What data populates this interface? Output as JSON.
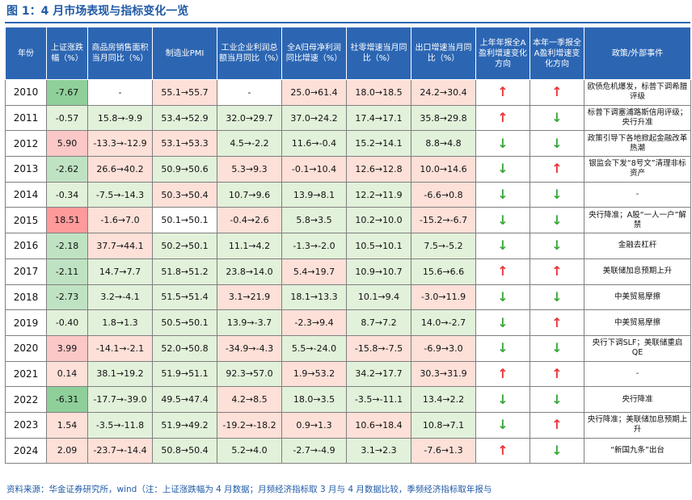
{
  "title": "图 1：4 月市场表现与指标变化一览",
  "colors": {
    "header_bg": "#2c66b3",
    "up_arrow": "#e8333a",
    "down_arrow": "#39a73a",
    "pos_strong": "#ff9a9a",
    "pos_light": "#fde0d8",
    "neg_strong": "#8fcf9a",
    "neg_light": "#e2f1da",
    "neutral": "#ffffff"
  },
  "chart_data": {
    "type": "table",
    "columns": [
      "年份",
      "上证涨跌幅（%）",
      "商品房销售面积当月同比（%）",
      "制造业PMI",
      "工业企业利润总额当月同比（%）",
      "全A归母净利润同比增速（%）",
      "社零增速当月同比（%）",
      "出口增速当月同比（%）",
      "上年年报全A盈利增速变化方向",
      "本年一季报全A盈利增速变化方向",
      "政策/外部事件"
    ],
    "rows": [
      {
        "year": "2010",
        "sse": "-7.67",
        "sales": "-",
        "pmi": "55.1→55.7",
        "profit": "-",
        "net": "25.0→61.4",
        "retail": "18.0→18.5",
        "export": "24.2→30.4",
        "annual": "up",
        "q1": "up",
        "event": "欧债危机爆发，标普下调希腊评级"
      },
      {
        "year": "2011",
        "sse": "-0.57",
        "sales": "15.8→-9.9",
        "pmi": "53.4→52.9",
        "profit": "32.0→29.7",
        "net": "37.0→24.2",
        "retail": "17.4→17.1",
        "export": "35.8→29.8",
        "annual": "up",
        "q1": "down",
        "event": "标普下调塞浦路斯信用评级；央行升准"
      },
      {
        "year": "2012",
        "sse": "5.90",
        "sales": "-13.3→-12.9",
        "pmi": "53.1→53.3",
        "profit": "4.5→-2.2",
        "net": "11.6→-0.4",
        "retail": "15.2→14.1",
        "export": "8.8→4.8",
        "annual": "down",
        "q1": "down",
        "event": "政策引导下各地掀起金融改革热潮"
      },
      {
        "year": "2013",
        "sse": "-2.62",
        "sales": "26.6→40.2",
        "pmi": "50.9→50.6",
        "profit": "5.3→9.3",
        "net": "-0.1→10.4",
        "retail": "12.6→12.8",
        "export": "10.0→14.6",
        "annual": "down",
        "q1": "up",
        "event": "银监会下发“8号文”清理非标资产"
      },
      {
        "year": "2014",
        "sse": "-0.34",
        "sales": "-7.5→-14.3",
        "pmi": "50.3→50.4",
        "profit": "10.7→9.6",
        "net": "13.9→8.1",
        "retail": "12.2→11.9",
        "export": "-6.6→0.8",
        "annual": "down",
        "q1": "down",
        "event": "-"
      },
      {
        "year": "2015",
        "sse": "18.51",
        "sales": "-1.6→7.0",
        "pmi": "50.1→50.1",
        "profit": "-0.4→2.6",
        "net": "5.8→3.5",
        "retail": "10.2→10.0",
        "export": "-15.2→-6.7",
        "annual": "down",
        "q1": "down",
        "event": "央行降准；A股“一人一户”解禁"
      },
      {
        "year": "2016",
        "sse": "-2.18",
        "sales": "37.7→44.1",
        "pmi": "50.2→50.1",
        "profit": "11.1→4.2",
        "net": "-1.3→-2.0",
        "retail": "10.5→10.1",
        "export": "7.5→-5.2",
        "annual": "down",
        "q1": "down",
        "event": "金融去杠杆"
      },
      {
        "year": "2017",
        "sse": "-2.11",
        "sales": "14.7→7.7",
        "pmi": "51.8→51.2",
        "profit": "23.8→14.0",
        "net": "5.4→19.7",
        "retail": "10.9→10.7",
        "export": "15.6→6.6",
        "annual": "up",
        "q1": "up",
        "event": "美联储加息预期上升"
      },
      {
        "year": "2018",
        "sse": "-2.73",
        "sales": "3.2→-4.1",
        "pmi": "51.5→51.4",
        "profit": "3.1→21.9",
        "net": "18.1→13.3",
        "retail": "10.1→9.4",
        "export": "-3.0→11.9",
        "annual": "down",
        "q1": "down",
        "event": "中美贸易摩擦"
      },
      {
        "year": "2019",
        "sse": "-0.40",
        "sales": "1.8→1.3",
        "pmi": "50.5→50.1",
        "profit": "13.9→-3.7",
        "net": "-2.3→9.4",
        "retail": "8.7→7.2",
        "export": "14.0→-2.7",
        "annual": "down",
        "q1": "up",
        "event": "中美贸易摩擦"
      },
      {
        "year": "2020",
        "sse": "3.99",
        "sales": "-14.1→-2.1",
        "pmi": "52.0→50.8",
        "profit": "-34.9→-4.3",
        "net": "5.5→-24.0",
        "retail": "-15.8→-7.5",
        "export": "-6.9→3.0",
        "annual": "down",
        "q1": "down",
        "event": "央行下调SLF；美联储重启QE"
      },
      {
        "year": "2021",
        "sse": "0.14",
        "sales": "38.1→19.2",
        "pmi": "51.9→51.1",
        "profit": "92.3→57.0",
        "net": "1.9→53.2",
        "retail": "34.2→17.7",
        "export": "30.3→31.9",
        "annual": "up",
        "q1": "up",
        "event": "-"
      },
      {
        "year": "2022",
        "sse": "-6.31",
        "sales": "-17.7→-39.0",
        "pmi": "49.5→47.4",
        "profit": "4.2→8.5",
        "net": "18.0→3.5",
        "retail": "-3.5→-11.1",
        "export": "13.4→2.2",
        "annual": "down",
        "q1": "down",
        "event": "央行降准"
      },
      {
        "year": "2023",
        "sse": "1.54",
        "sales": "-3.5→-11.8",
        "pmi": "51.9→49.2",
        "profit": "-19.2→-18.2",
        "net": "0.9→1.3",
        "retail": "10.6→18.4",
        "export": "10.8→7.1",
        "annual": "down",
        "q1": "up",
        "event": "央行降准；美联储加息预期上升"
      },
      {
        "year": "2024",
        "sse": "2.09",
        "sales": "-23.7→-14.4",
        "pmi": "50.8→50.4",
        "profit": "5.2→4.0",
        "net": "-2.7→-4.9",
        "retail": "3.1→2.3",
        "export": "-7.6→1.3",
        "annual": "up",
        "q1": "down",
        "event": "“新国九条”出台"
      }
    ]
  },
  "footnote": "资料来源：华金证券研究所，wind（注：上证涨跌幅为 4 月数据；月频经济指标取 3 月与 4 月数据比较，季频经济指标取年报与"
}
